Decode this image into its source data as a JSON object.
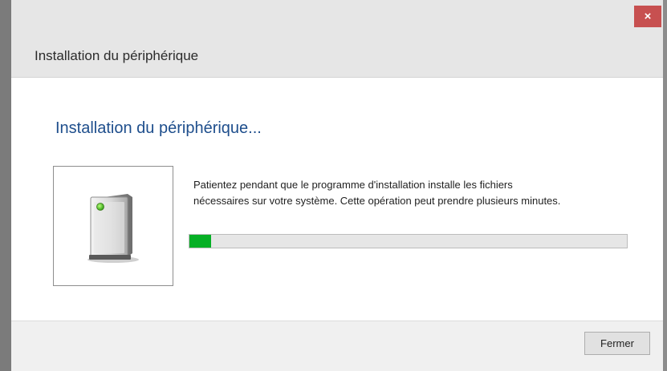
{
  "window": {
    "title": "Installation du périphérique",
    "close_glyph": "×"
  },
  "main": {
    "heading": "Installation du périphérique...",
    "device_icon": "device-tower-icon",
    "message_line1": "Patientez pendant que le programme d'installation installe les fichiers",
    "message_line2": "nécessaires sur votre système. Cette opération peut prendre plusieurs minutes.",
    "progress_fraction": 0.05,
    "progress_color": "#06b025"
  },
  "footer": {
    "close_button_label": "Fermer"
  }
}
